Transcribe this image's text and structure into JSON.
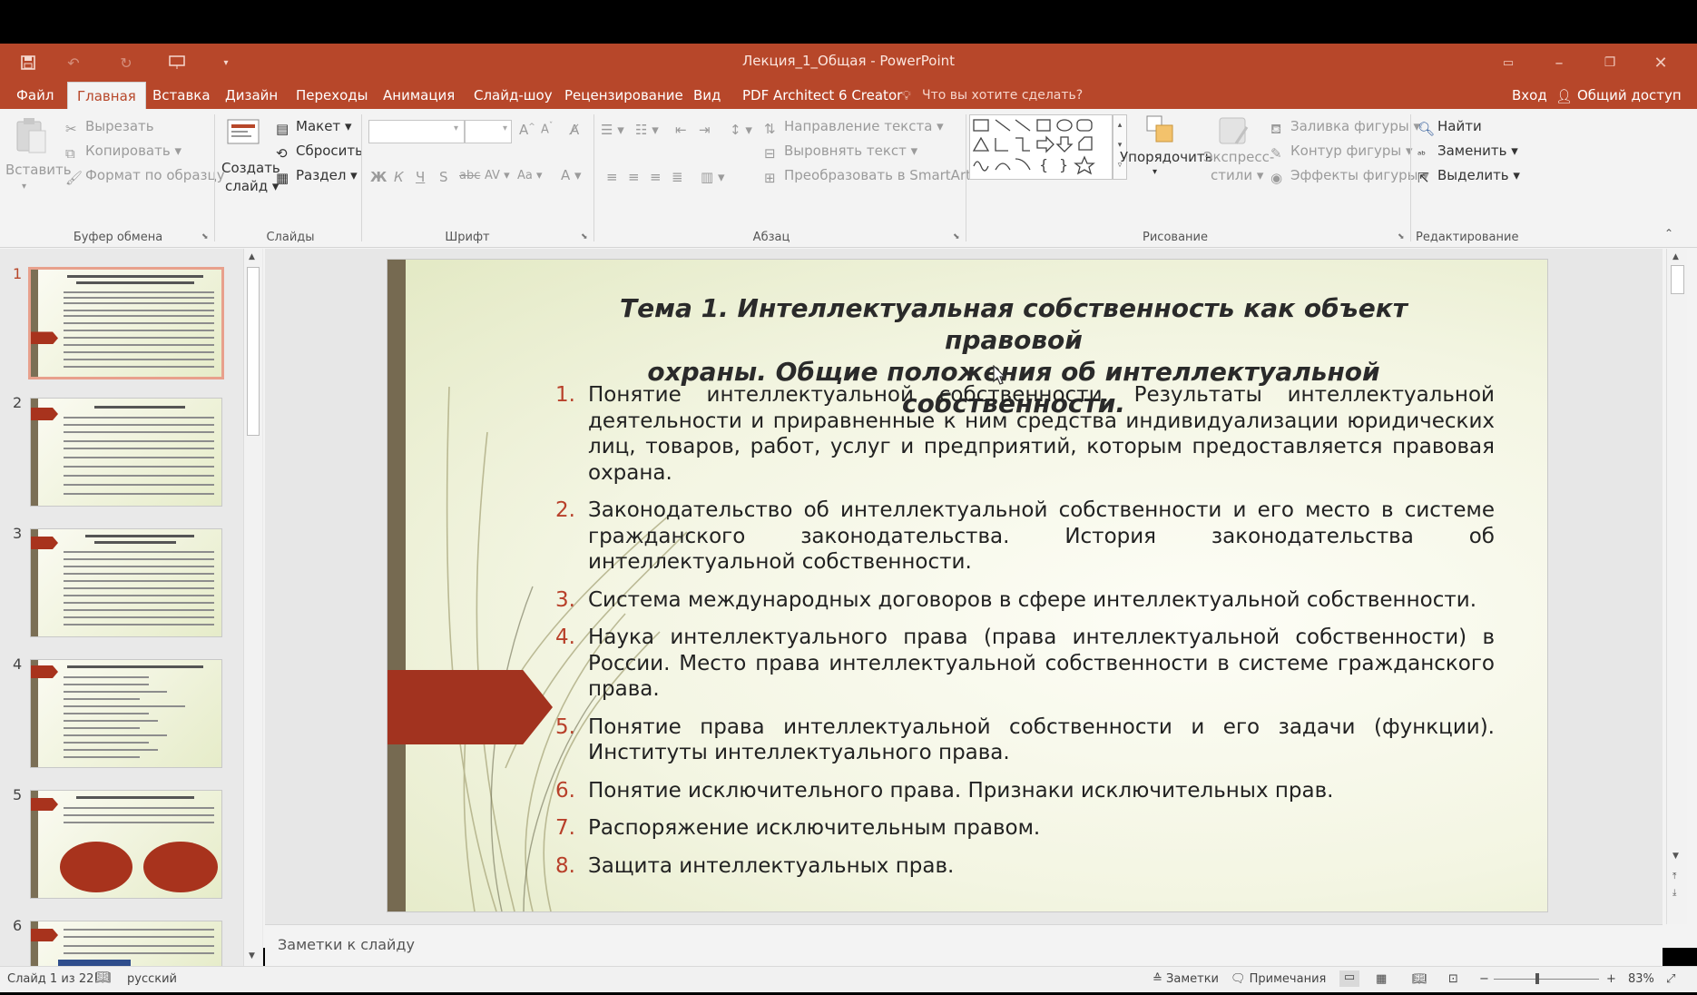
{
  "window": {
    "title": "Лекция_1_Общая - PowerPoint"
  },
  "tabs": {
    "file": "Файл",
    "home": "Главная",
    "insert": "Вставка",
    "design": "Дизайн",
    "transitions": "Переходы",
    "animation": "Анимация",
    "slideshow": "Слайд-шоу",
    "review": "Рецензирование",
    "view": "Вид",
    "pdf": "PDF Architect 6 Creator",
    "tellme": "Что вы хотите сделать?",
    "signin": "Вход",
    "share": "Общий доступ"
  },
  "ribbon": {
    "clipboard": {
      "paste": "Вставить",
      "cut": "Вырезать",
      "copy": "Копировать",
      "format_painter": "Формат по образцу",
      "group": "Буфер обмена"
    },
    "slides": {
      "new_slide_1": "Создать",
      "new_slide_2": "слайд",
      "layout": "Макет",
      "reset": "Сбросить",
      "section": "Раздел",
      "group": "Слайды"
    },
    "font": {
      "group": "Шрифт"
    },
    "paragraph": {
      "text_direction": "Направление текста",
      "align_text": "Выровнять текст",
      "smartart": "Преобразовать в SmartArt",
      "group": "Абзац"
    },
    "drawing": {
      "arrange": "Упорядочить",
      "quick_styles_1": "Экспресс-",
      "quick_styles_2": "стили",
      "shape_fill": "Заливка фигуры",
      "shape_outline": "Контур фигуры",
      "shape_effects": "Эффекты фигуры",
      "group": "Рисование"
    },
    "editing": {
      "find": "Найти",
      "replace": "Заменить",
      "select": "Выделить",
      "group": "Редактирование"
    }
  },
  "thumbnails": [
    "1",
    "2",
    "3",
    "4",
    "5",
    "6"
  ],
  "slide": {
    "title_line1": "Тема 1. Интеллектуальная собственность как объект правовой",
    "title_line2": "охраны. Общие положения об интеллектуальной собственности.",
    "items": [
      {
        "num": "1.",
        "text": "Понятие интеллектуальной собственности. Результаты интеллектуальной деятельности и приравненные к ним средства индивидуализации юридических лиц, товаров, работ, услуг и предприятий, которым предоставляется правовая охрана."
      },
      {
        "num": "2.",
        "text": "Законодательство об интеллектуальной собственности и его место в системе гражданского законодательства. История законодательства об интеллектуальной собственности."
      },
      {
        "num": "3.",
        "text": "Система международных договоров в сфере интеллектуальной собственности."
      },
      {
        "num": "4.",
        "text": "Наука интеллектуального права (права интеллектуальной собственности) в России. Место права интеллектуальной собственности в системе гражданского права."
      },
      {
        "num": "5.",
        "text": "Понятие права интеллектуальной собственности и его задачи (функции). Институты интеллектуального права."
      },
      {
        "num": "6.",
        "text": "Понятие исключительного права. Признаки исключительных прав."
      },
      {
        "num": "7.",
        "text": "Распоряжение исключительным правом."
      },
      {
        "num": "8.",
        "text": "Защита интеллектуальных прав."
      }
    ]
  },
  "notes": {
    "placeholder": "Заметки к слайду"
  },
  "status": {
    "slide_info": "Слайд 1 из 22",
    "language": "русский",
    "notes": "Заметки",
    "comments": "Примечания",
    "zoom": "83%"
  },
  "colors": {
    "accent": "#b7472a",
    "slide_bar": "#766a51",
    "slide_arrow": "#a2331f",
    "list_number": "#b8402a"
  }
}
